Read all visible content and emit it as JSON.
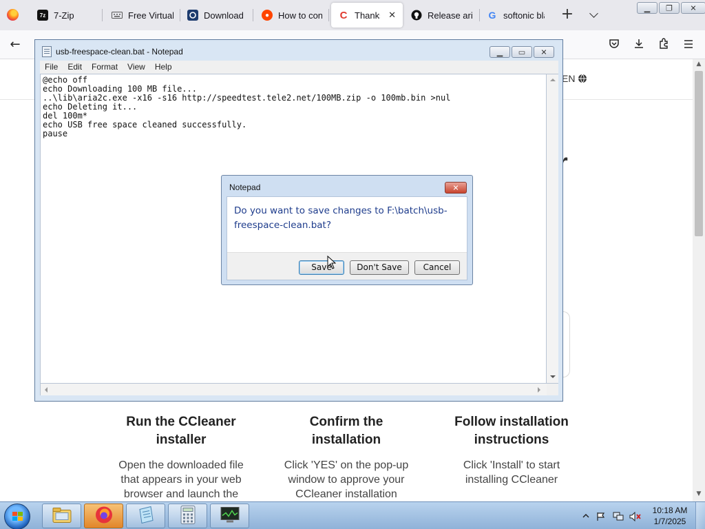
{
  "browser": {
    "tabs": [
      {
        "label": "7-Zip",
        "icon": "7zip-icon"
      },
      {
        "label": "Free Virtual",
        "icon": "keyboard-icon"
      },
      {
        "label": "Download M",
        "icon": "download-site-icon"
      },
      {
        "label": "How to con",
        "icon": "reddit-icon"
      },
      {
        "label": "Thanks fo",
        "icon": "ccleaner-icon",
        "active": true
      },
      {
        "label": "Release aria",
        "icon": "github-icon"
      },
      {
        "label": "softonic bla",
        "icon": "google-icon"
      }
    ],
    "new_tab_glyph": "+",
    "nav_back_glyph": "←"
  },
  "page": {
    "language": "EN",
    "heading_fragment": "r",
    "steps": [
      {
        "title": "Run the CCleaner installer",
        "text": "Open the downloaded file that appears in your web browser and launch the"
      },
      {
        "title": "Confirm the installation",
        "text": "Click 'YES' on the pop-up window to approve your CCleaner installation"
      },
      {
        "title": "Follow installation instructions",
        "text": "Click 'Install' to start installing CCleaner"
      }
    ]
  },
  "notepad": {
    "title": "usb-freespace-clean.bat - Notepad",
    "menu": [
      "File",
      "Edit",
      "Format",
      "View",
      "Help"
    ],
    "lines": [
      "@echo off",
      "echo Downloading 100 MB file...",
      "..\\lib\\aria2c.exe -x16 -s16 http://speedtest.tele2.net/100MB.zip -o 100mb.bin >nul",
      "echo Deleting it...",
      "del 100m*",
      "echo USB free space cleaned successfully.",
      "pause"
    ]
  },
  "dialog": {
    "title": "Notepad",
    "message": "Do you want to save changes to F:\\batch\\usb-freespace-clean.bat?",
    "buttons": {
      "save": "Save",
      "dont_save": "Don't Save",
      "cancel": "Cancel"
    }
  },
  "taskbar": {
    "time": "10:18 AM",
    "date": "1/7/2025",
    "items": [
      "explorer-icon",
      "firefox-icon",
      "notepad-icon",
      "calculator-icon",
      "task-manager-icon"
    ]
  },
  "colors": {
    "dialog_message": "#1e3c8c",
    "taskbar": "#a7c4e6",
    "active_taskbar_item": "#e2862a"
  }
}
